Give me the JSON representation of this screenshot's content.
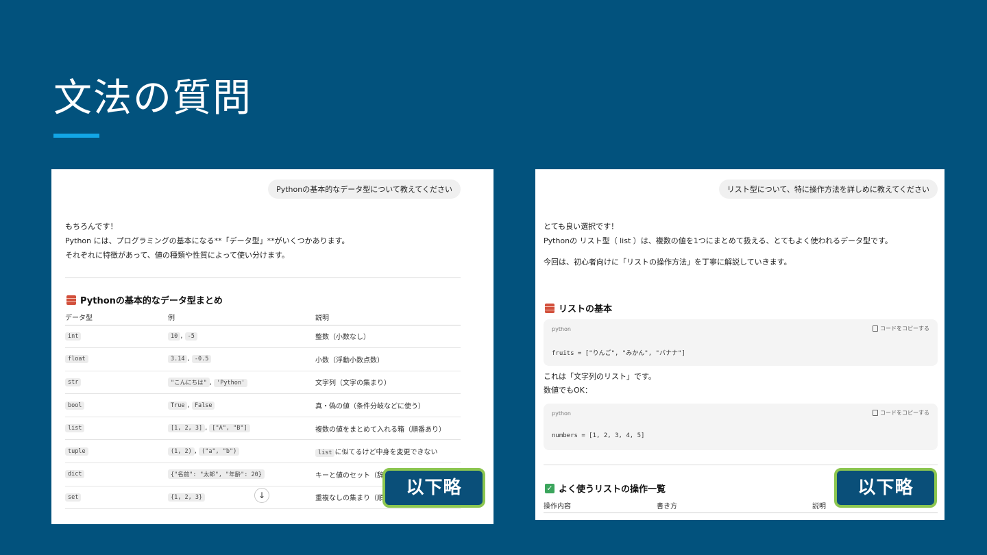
{
  "slide": {
    "title": "文法の質問"
  },
  "left": {
    "user_bubble": "Pythonの基本的なデータ型について教えてください",
    "answer": [
      "もちろんです！",
      "Python には、プログラミングの基本になる**「データ型」**がいくつかあります。",
      "それぞれに特徴があって、値の種類や性質によって使い分けます。"
    ],
    "section_title": "Pythonの基本的なデータ型まとめ",
    "section_icon": "brick-emoji",
    "table": {
      "headers": [
        "データ型",
        "例",
        "説明"
      ],
      "rows": [
        {
          "type": "int",
          "ex1": "10",
          "ex2": "-5",
          "desc": "整数（小数なし）"
        },
        {
          "type": "float",
          "ex1": "3.14",
          "ex2": "-0.5",
          "desc": "小数（浮動小数点数）"
        },
        {
          "type": "str",
          "ex1": "\"こんにちは\"",
          "ex2": "'Python'",
          "desc": "文字列（文字の集まり）"
        },
        {
          "type": "bool",
          "ex1": "True",
          "ex2": "False",
          "desc": "真・偽の値（条件分岐などに使う）"
        },
        {
          "type": "list",
          "ex1": "[1, 2, 3]",
          "ex2": "[\"A\", \"B\"]",
          "desc": "複数の値をまとめて入れる箱（順番あり）"
        },
        {
          "type": "tuple",
          "ex1": "(1, 2)",
          "ex2": "(\"a\", \"b\")",
          "desc_code": "list",
          "desc": "に似てるけど中身を変更できない"
        },
        {
          "type": "dict",
          "ex1": "{\"名前\": \"太郎\", \"年齢\": 20}",
          "ex2": "",
          "desc": "キーと値のセット（辞書）"
        },
        {
          "type": "set",
          "ex1": "{1, 2, 3}",
          "ex2": "",
          "desc": "重複なしの集まり（順番なし）"
        }
      ]
    },
    "scroll_icon": "arrow-down-icon",
    "omit_label": "以下略"
  },
  "right": {
    "user_bubble": "リスト型について、特に操作方法を詳しめに教えてください",
    "answer": [
      "とても良い選択です！",
      "Pythonの リスト型（ list ）は、複数の値を1つにまとめて扱える、とてもよく使われるデータ型です。",
      "今回は、初心者向けに「リストの操作方法」を丁寧に解説していきます。"
    ],
    "section_title": "リストの基本",
    "code1": {
      "lang": "python",
      "copy_label": "コードをコピーする",
      "code": "fruits = [\"りんご\", \"みかん\", \"バナナ\"]"
    },
    "mid_text": [
      "これは「文字列のリスト」です。",
      "数値でもOK："
    ],
    "code2": {
      "lang": "python",
      "copy_label": "コードをコピーする",
      "code": "numbers = [1, 2, 3, 4, 5]"
    },
    "section2_title": "よく使うリストの操作一覧",
    "table_headers": [
      "操作内容",
      "書き方",
      "説明"
    ],
    "omit_label": "以下略"
  },
  "colors": {
    "background": "#02527d",
    "accent": "#12a6e6",
    "omit_border": "#8cc650",
    "omit_fill": "#0a4f79"
  }
}
